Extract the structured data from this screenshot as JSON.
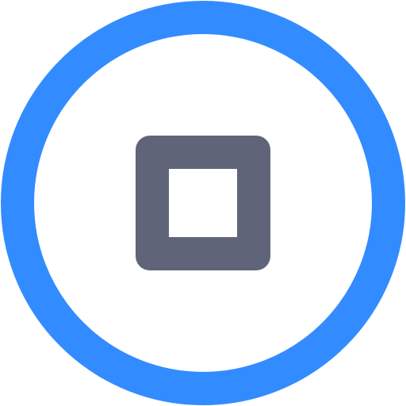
{
  "control": {
    "type": "stop-button",
    "icon": "stop-icon"
  },
  "colors": {
    "background": "#ffffff",
    "ring": "#338cff",
    "icon": "#5f6479",
    "icon_inner": "#ffffff"
  }
}
